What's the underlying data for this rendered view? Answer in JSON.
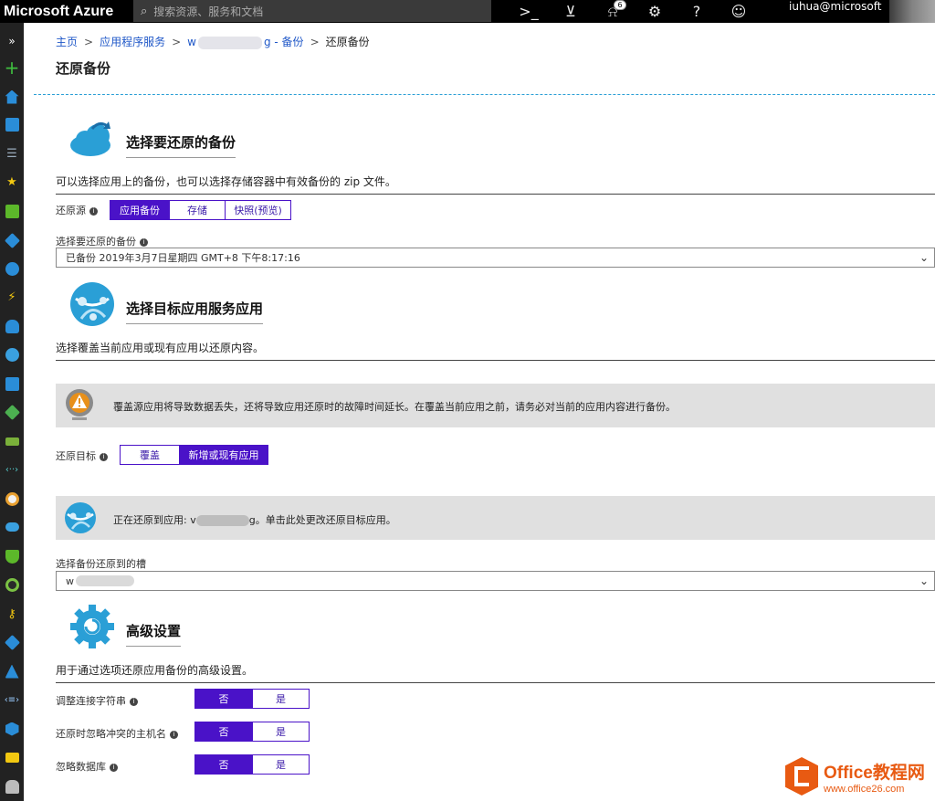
{
  "topbar": {
    "brand": "Microsoft Azure",
    "search_placeholder": "搜索资源、服务和文档",
    "notification_count": "6",
    "user": "iuhua@microsoft"
  },
  "breadcrumb": {
    "home": "主页",
    "app_services": "应用程序服务",
    "app_prefix": "w",
    "app_suffix": "g - 备份",
    "current": "还原备份"
  },
  "page_title": "还原备份",
  "section_backup": {
    "title": "选择要还原的备份",
    "description": "可以选择应用上的备份，也可以选择存储容器中有效备份的 zip 文件。",
    "source_label": "还原源",
    "source_options": [
      "应用备份",
      "存储",
      "快照(预览)"
    ],
    "backup_label": "选择要还原的备份",
    "backup_value": "已备份 2019年3月7日星期四 GMT+8 下午8:17:16"
  },
  "section_target": {
    "title": "选择目标应用服务应用",
    "description": "选择覆盖当前应用或现有应用以还原内容。",
    "warning": "覆盖源应用将导致数据丢失，还将导致应用还原时的故障时间延长。在覆盖当前应用之前，请务必对当前的应用内容进行备份。",
    "target_label": "还原目标",
    "target_options": [
      "覆盖",
      "新增或现有应用"
    ],
    "restoring_prefix": "正在还原到应用: v",
    "restoring_suffix": "g。单击此处更改还原目标应用。",
    "slot_label": "选择备份还原到的槽",
    "slot_value": "w"
  },
  "section_advanced": {
    "title": "高级设置",
    "description": "用于通过选项还原应用备份的高级设置。",
    "settings": [
      {
        "label": "调整连接字符串",
        "options": [
          "否",
          "是"
        ]
      },
      {
        "label": "还原时忽略冲突的主机名",
        "options": [
          "否",
          "是"
        ]
      },
      {
        "label": "忽略数据库",
        "options": [
          "否",
          "是"
        ]
      }
    ]
  },
  "watermark": {
    "title": "Office教程网",
    "url": "www.office26.com"
  },
  "colors": {
    "accent": "#4a12c8",
    "topbar": "#000000",
    "leftnav": "#222222",
    "banner": "#e0e0e0",
    "link": "#2058c8"
  }
}
